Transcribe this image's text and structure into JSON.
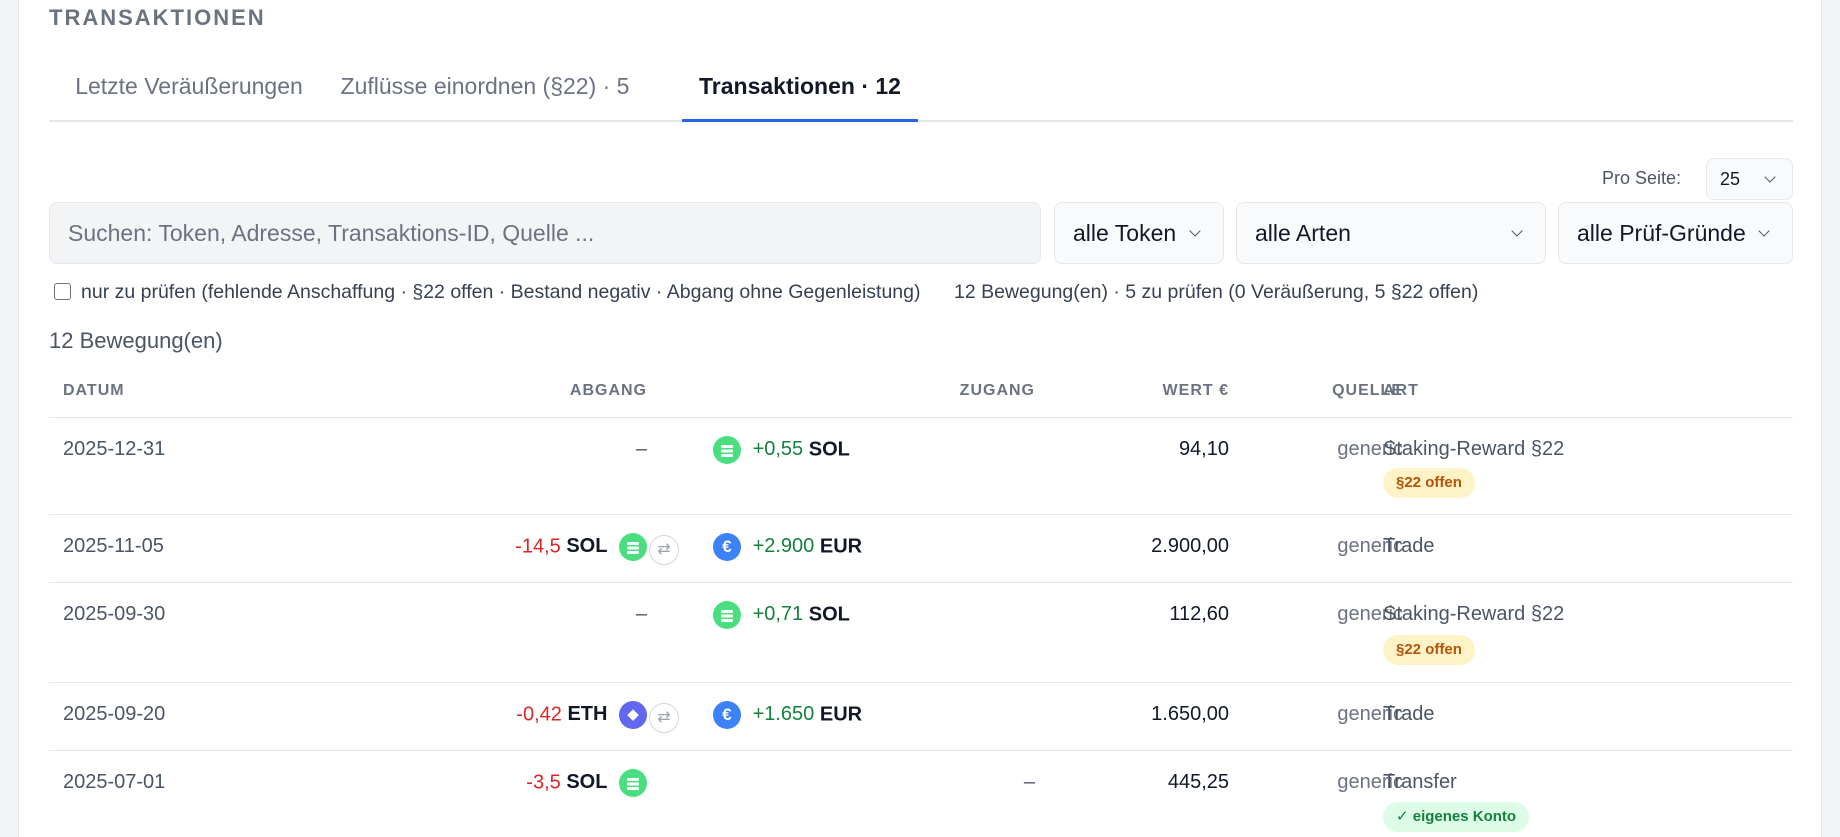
{
  "section": {
    "title": "TRANSAKTIONEN"
  },
  "tabs": [
    {
      "label": "Letzte Veräußerungen",
      "active": false
    },
    {
      "label": "Zuflüsse einordnen (§22) · 5",
      "active": false
    },
    {
      "label": "Transaktionen · 12",
      "active": true
    }
  ],
  "pager": {
    "label": "Pro Seite:",
    "value": "25"
  },
  "search": {
    "placeholder": "Suchen: Token, Adresse, Transaktions-ID, Quelle ..."
  },
  "filters": {
    "token": "alle Token",
    "type": "alle Arten",
    "reason": "alle Prüf-Gründe"
  },
  "review_filter": {
    "label": "nur zu prüfen (fehlende Anschaffung · §22 offen · Bestand negativ · Abgang ohne Gegenleistung)",
    "checked": false
  },
  "summary": "12 Bewegung(en) · 5 zu prüfen (0 Veräußerung, 5 §22 offen)",
  "count_label": "12 Bewegung(en)",
  "table": {
    "headers": {
      "date": "DATUM",
      "out": "ABGANG",
      "in": "ZUGANG",
      "value": "WERT €",
      "source": "QUELLE",
      "type": "ART"
    },
    "rows": [
      {
        "date": "2025-12-31",
        "out_amount": "",
        "out_symbol": "",
        "out_dash": "–",
        "in_amount": "+0,55",
        "in_symbol": "SOL",
        "in_dash": "",
        "value": "94,10",
        "source": "generic",
        "type": "Staking-Reward §22",
        "badge": "§22 offen"
      },
      {
        "date": "2025-11-05",
        "out_amount": "-14,5",
        "out_symbol": "SOL",
        "out_dash": "",
        "swap": "⇄",
        "in_amount": "+2.900",
        "in_symbol": "EUR",
        "in_dash": "",
        "value": "2.900,00",
        "source": "generic",
        "type": "Trade",
        "badge": ""
      },
      {
        "date": "2025-09-30",
        "out_amount": "",
        "out_symbol": "",
        "out_dash": "–",
        "in_amount": "+0,71",
        "in_symbol": "SOL",
        "in_dash": "",
        "value": "112,60",
        "source": "generic",
        "type": "Staking-Reward §22",
        "badge": "§22 offen"
      },
      {
        "date": "2025-09-20",
        "out_amount": "-0,42",
        "out_symbol": "ETH",
        "out_dash": "",
        "swap": "⇄",
        "in_amount": "+1.650",
        "in_symbol": "EUR",
        "in_dash": "",
        "value": "1.650,00",
        "source": "generic",
        "type": "Trade",
        "badge": ""
      },
      {
        "date": "2025-07-01",
        "out_amount": "-3,5",
        "out_symbol": "SOL",
        "out_dash": "",
        "in_amount": "",
        "in_symbol": "",
        "in_dash": "–",
        "value": "445,25",
        "source": "generic",
        "type": "Transfer",
        "badge": "✓ eigenes Konto"
      }
    ]
  },
  "icons": {
    "sol": "sol-token-icon",
    "eur": "eur-token-icon",
    "eth": "eth-token-icon",
    "swap": "swap-icon"
  },
  "colors": {
    "accent": "#2563eb",
    "negative": "#dc2626",
    "positive": "#15803d",
    "badge_open": "#b45309",
    "badge_own": "#15803d"
  }
}
